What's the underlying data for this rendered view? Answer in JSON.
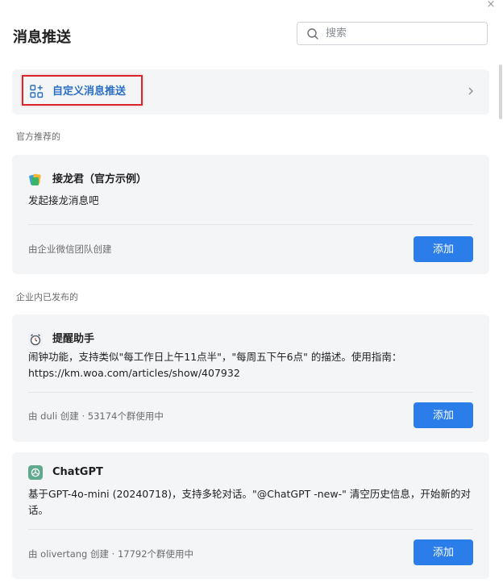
{
  "window": {
    "close_icon": "close-icon"
  },
  "header": {
    "title": "消息推送",
    "search": {
      "placeholder": "搜索",
      "icon": "search-icon"
    }
  },
  "custom_push": {
    "label": "自定义消息推送",
    "icon": "apps-grid-plus-icon",
    "chevron": "chevron-right-icon",
    "highlight_color": "#d9262b"
  },
  "sections": {
    "official": "官方推荐的",
    "published": "企业内已发布的"
  },
  "cards": [
    {
      "name": "接龙君（官方示例）",
      "icon": "jielong-icon",
      "description": "发起接龙消息吧",
      "meta": "由企业微信团队创建",
      "button": "添加"
    },
    {
      "name": "提醒助手",
      "icon": "alarm-clock-icon",
      "description": "闹钟功能，支持类似\"每工作日上午11点半\"，\"每周五下午6点\" 的描述。使用指南： https://km.woa.com/articles/show/407932",
      "meta": "由 duli 创建 · 53174个群使用中",
      "button": "添加"
    },
    {
      "name": "ChatGPT",
      "icon": "chatgpt-icon",
      "description": "基于GPT-4o-mini (20240718)，支持多轮对话。\"@ChatGPT -new-\" 清空历史信息，开始新的对话。",
      "meta": "由 olivertang 创建 · 17792个群使用中",
      "button": "添加"
    }
  ],
  "colors": {
    "accent": "#2b7de9",
    "link": "#2a6fc4",
    "card_bg": "#f4f5f7"
  }
}
